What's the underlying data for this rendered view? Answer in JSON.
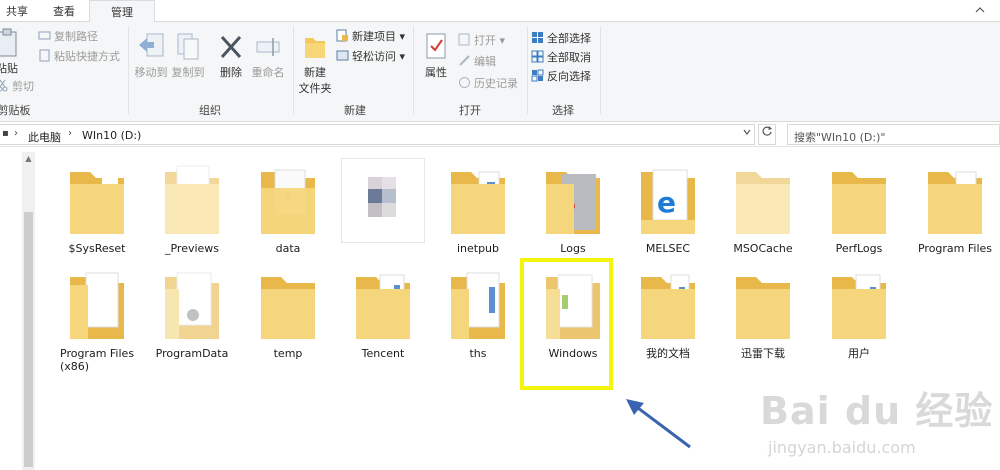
{
  "tabs": [
    {
      "label": "共享"
    },
    {
      "label": "查看"
    },
    {
      "label": "管理"
    }
  ],
  "ribbon": {
    "clipboard": {
      "paste": "粘贴",
      "copy_path": "复制路径",
      "paste_shortcut": "粘贴快捷方式",
      "cut": "剪切",
      "group_label": "剪贴板"
    },
    "organize": {
      "move_to": "移动到",
      "copy_to": "复制到",
      "delete": "删除",
      "rename": "重命名",
      "group_label": "组织"
    },
    "new": {
      "new_folder_line1": "新建",
      "new_folder_line2": "文件夹",
      "new_item": "新建项目",
      "easy_access": "轻松访问",
      "group_label": "新建"
    },
    "open": {
      "properties": "属性",
      "open": "打开",
      "edit": "编辑",
      "history": "历史记录",
      "group_label": "打开"
    },
    "select": {
      "select_all": "全部选择",
      "select_none": "全部取消",
      "invert": "反向选择",
      "group_label": "选择"
    }
  },
  "address": {
    "this_pc": "此电脑",
    "drive": "WIn10 (D:)",
    "search_placeholder": "搜索\"WIn10 (D:)\""
  },
  "items": [
    {
      "label": "$SysReset"
    },
    {
      "label": "_Previews"
    },
    {
      "label": "data"
    },
    {
      "label": ""
    },
    {
      "label": "inetpub"
    },
    {
      "label": "Logs"
    },
    {
      "label": "MELSEC"
    },
    {
      "label": "MSOCache"
    },
    {
      "label": "PerfLogs"
    },
    {
      "label": "Program Files"
    },
    {
      "label": "Program Files (x86)"
    },
    {
      "label": "ProgramData"
    },
    {
      "label": "temp"
    },
    {
      "label": "Tencent"
    },
    {
      "label": "ths"
    },
    {
      "label": "Windows"
    },
    {
      "label": "我的文档"
    },
    {
      "label": "迅雷下载"
    },
    {
      "label": "用户"
    }
  ],
  "watermark": {
    "brand": "Bai du 经验",
    "url": "jingyan.baidu.com"
  },
  "colors": {
    "folder": "#f5d67c",
    "folder_dark": "#e8b84a",
    "highlight": "#f5f40d",
    "arrow": "#3a63b0"
  }
}
